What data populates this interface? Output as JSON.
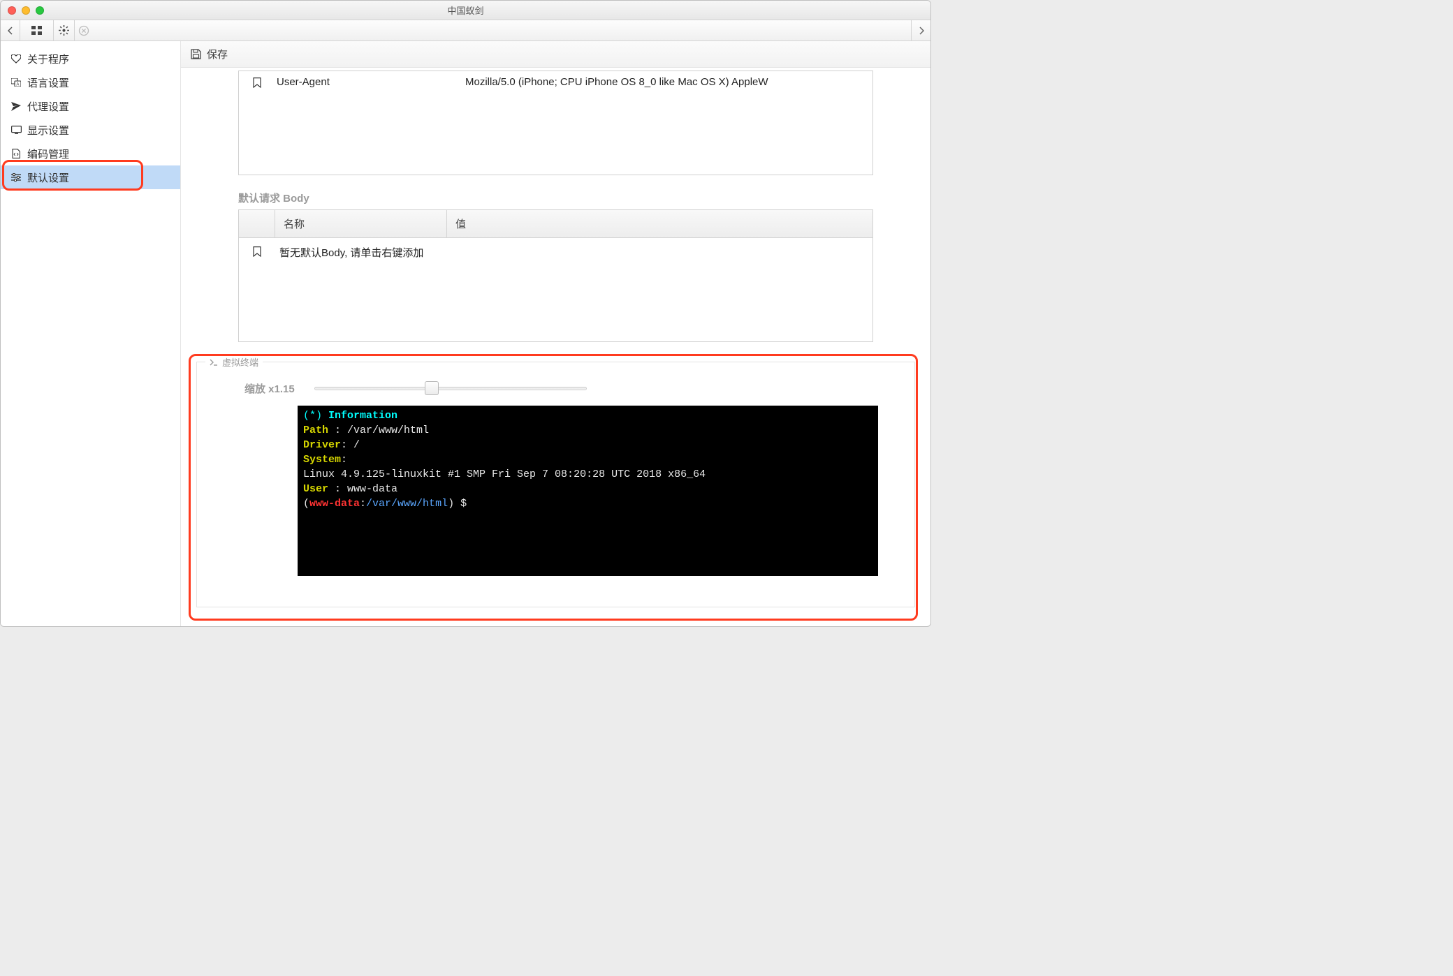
{
  "window": {
    "title": "中国蚁剑"
  },
  "sidebar": {
    "items": [
      {
        "label": "关于程序"
      },
      {
        "label": "语言设置"
      },
      {
        "label": "代理设置"
      },
      {
        "label": "显示设置"
      },
      {
        "label": "编码管理"
      },
      {
        "label": "默认设置"
      }
    ]
  },
  "toolbar": {
    "save_label": "保存"
  },
  "headers_table": {
    "rows": [
      {
        "name": "User-Agent",
        "value": "Mozilla/5.0 (iPhone; CPU iPhone OS 8_0 like Mac OS X) AppleW"
      }
    ]
  },
  "body_section": {
    "title": "默认请求 Body",
    "columns": {
      "name": "名称",
      "value": "值"
    },
    "empty_text": "暂无默认Body, 请单击右键添加"
  },
  "terminal_section": {
    "legend": "虚拟终端",
    "zoom_label": "缩放 x1.15",
    "slider_value": 1.15,
    "lines": {
      "info_star": "(*) ",
      "info_word": "Information",
      "path_label": "Path  ",
      "path_sep": ": ",
      "path_value": "/var/www/html",
      "driver_label": "Driver",
      "driver_sep": ": ",
      "driver_value": "/",
      "system_label": "System",
      "system_sep": ":",
      "system_value": "Linux 4.9.125-linuxkit #1 SMP Fri Sep 7 08:20:28 UTC 2018 x86_64",
      "user_label": "User  ",
      "user_sep": ": ",
      "user_value": "www-data",
      "prompt_open": "(",
      "prompt_user": "www-data",
      "prompt_colon": ":",
      "prompt_path": "/var/www/html",
      "prompt_close": ") $"
    }
  }
}
